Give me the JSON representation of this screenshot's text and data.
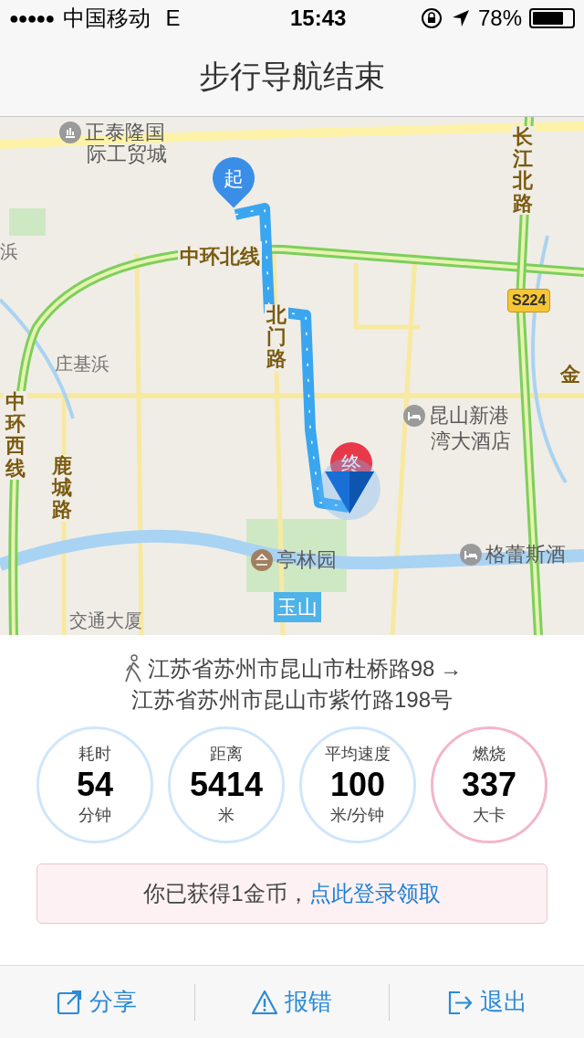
{
  "status_bar": {
    "signal_dots": "●●●●●",
    "carrier": "中国移动",
    "network": "E",
    "time": "15:43",
    "battery": "78%"
  },
  "nav_bar": {
    "title": "步行导航结束"
  },
  "map": {
    "labels": [
      {
        "text": "正泰隆国",
        "kind": "poi"
      },
      {
        "text": "际工贸城",
        "kind": "plain"
      },
      {
        "text": "中环北线",
        "kind": "ring"
      },
      {
        "text": "长江北路",
        "kind": "vroad"
      },
      {
        "text": "S224",
        "kind": "shield"
      },
      {
        "text": "浜",
        "kind": "district"
      },
      {
        "text": "庄基浜",
        "kind": "district"
      },
      {
        "text": "北门路",
        "kind": "vroad"
      },
      {
        "text": "金",
        "kind": "road"
      },
      {
        "text": "中环西线",
        "kind": "vring"
      },
      {
        "text": "鹿城路",
        "kind": "vroad"
      },
      {
        "text": "昆山新港",
        "kind": "hotel"
      },
      {
        "text": "湾大酒店",
        "kind": "plain"
      },
      {
        "text": "格蕾斯酒",
        "kind": "hotel"
      },
      {
        "text": "亭林园",
        "kind": "park"
      },
      {
        "text": "玉山",
        "kind": "station"
      },
      {
        "text": "交通大厦",
        "kind": "district"
      }
    ],
    "start_marker": "起",
    "end_marker": "终"
  },
  "summary": {
    "from": "江苏省苏州市昆山市杜桥路98",
    "arrow": "→",
    "to": "江苏省苏州市昆山市紫竹路198号",
    "stats": [
      {
        "label": "耗时",
        "value": "54",
        "unit": "分钟",
        "color": "#cfe6fb"
      },
      {
        "label": "距离",
        "value": "5414",
        "unit": "米",
        "color": "#cfe6fb"
      },
      {
        "label": "平均速度",
        "value": "100",
        "unit": "米/分钟",
        "color": "#cfe6fb"
      },
      {
        "label": "燃烧",
        "value": "337",
        "unit": "大卡",
        "color": "#f3b6c9"
      }
    ],
    "reward": {
      "text": "你已获得1金币，",
      "link": "点此登录领取"
    }
  },
  "toolbar": [
    {
      "label": "分享",
      "kind": "share"
    },
    {
      "label": "报错",
      "kind": "report"
    },
    {
      "label": "退出",
      "kind": "exit"
    }
  ]
}
